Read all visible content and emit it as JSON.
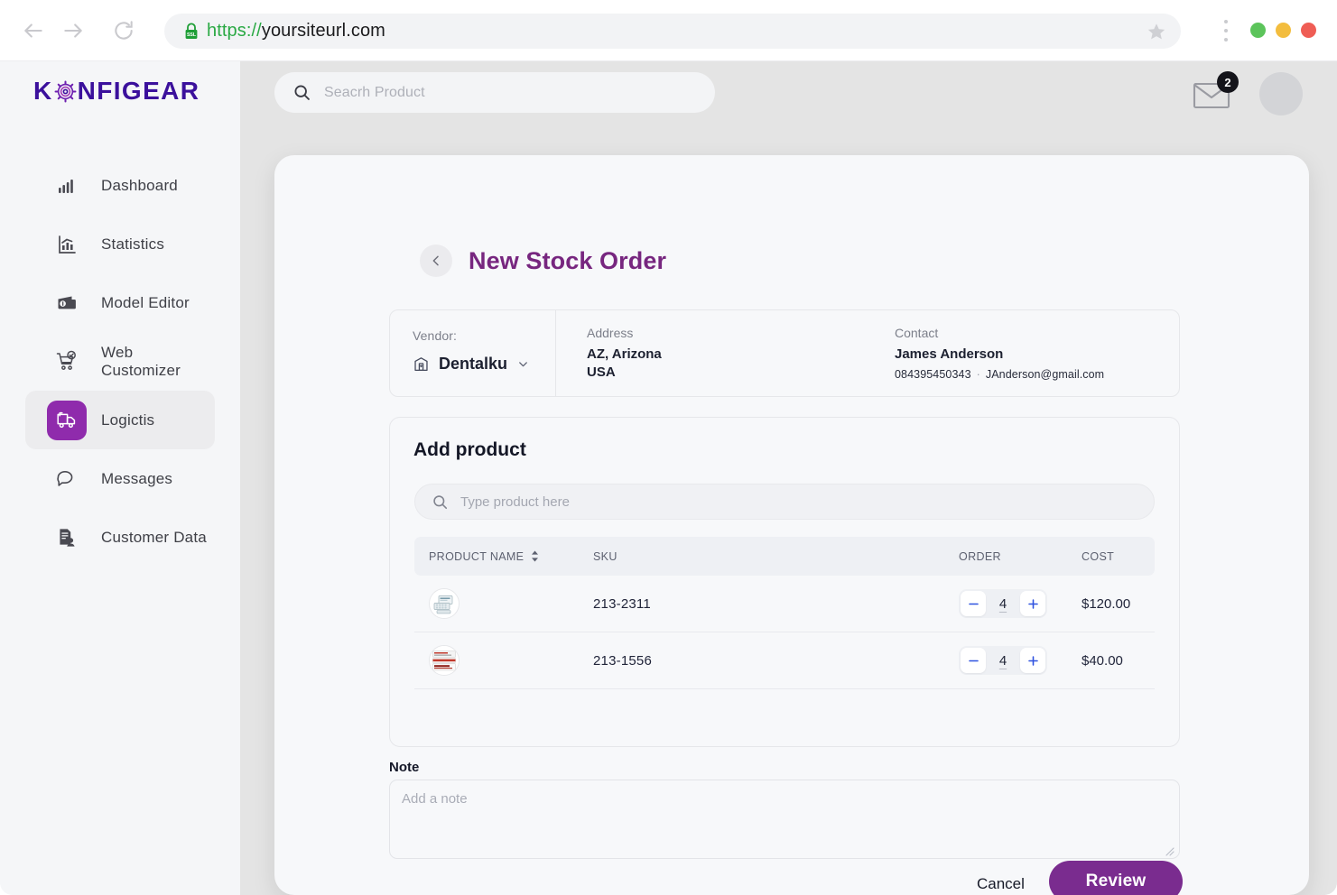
{
  "browser": {
    "back_icon": "arrow-left-icon",
    "forward_icon": "arrow-right-icon",
    "reload_icon": "reload-icon",
    "lock_label": "SSL",
    "url_scheme": "https://",
    "url_host": "yoursiteurl.com",
    "bookmark_icon": "star-icon",
    "menu_icon": "kebab-menu-icon",
    "window_dots": [
      "#5cc45b",
      "#f3bd3e",
      "#ef5d55"
    ]
  },
  "sidebar": {
    "logo": {
      "before": "K",
      "gear": "gear-icon",
      "after": "NFIGEAR"
    },
    "items": [
      {
        "label": "Dashboard",
        "icon": "bar-chart-icon",
        "active": false
      },
      {
        "label": "Statistics",
        "icon": "statistics-chart-icon",
        "active": false
      },
      {
        "label": "Model Editor",
        "icon": "wallet-icon",
        "active": false
      },
      {
        "label": "Web Customizer",
        "icon": "cart-check-icon",
        "active": false
      },
      {
        "label": "Logictis",
        "icon": "truck-icon",
        "active": true
      },
      {
        "label": "Messages",
        "icon": "chat-bubble-icon",
        "active": false
      },
      {
        "label": "Customer Data",
        "icon": "document-user-icon",
        "active": false
      }
    ],
    "active_color": "#8f2bac"
  },
  "topbar": {
    "search_placeholder": "Seacrh Product",
    "search_value": "",
    "search_icon": "search-icon",
    "mail_icon": "envelope-icon",
    "mail_badge": "2",
    "avatar": "user-avatar"
  },
  "page": {
    "back_icon": "chevron-left-icon",
    "title": "New Stock Order",
    "title_color": "#77267f"
  },
  "vendor": {
    "vendor_label": "Vendor:",
    "vendor_name": "Dentalku",
    "vendor_icon": "clinic-building-icon",
    "chevron_icon": "chevron-down-icon",
    "address_label": "Address",
    "address_line1": "AZ, Arizona",
    "address_line2": "USA",
    "contact_label": "Contact",
    "contact_name": "James Anderson",
    "contact_phone": "084395450343",
    "contact_separator": "·",
    "contact_email": "JAnderson@gmail.com"
  },
  "add_product": {
    "title": "Add product",
    "search_placeholder": "Type product here",
    "search_value": "",
    "search_icon": "search-icon",
    "columns": {
      "product_name": "PRODUCT NAME",
      "sku": "SKU",
      "order": "ORDER",
      "cost": "COST",
      "sort_icon": "sort-arrows-icon"
    },
    "rows": [
      {
        "thumb": "product-thumbnail-blister-pack",
        "sku": "213-2311",
        "quantity": "4",
        "cost": "$120.00",
        "minus_icon": "minus-icon",
        "plus_icon": "plus-icon"
      },
      {
        "thumb": "product-thumbnail-red-box",
        "sku": "213-1556",
        "quantity": "4",
        "cost": "$40.00",
        "minus_icon": "minus-icon",
        "plus_icon": "plus-icon"
      }
    ]
  },
  "note": {
    "label": "Note",
    "placeholder": "Add a note",
    "value": "",
    "resize_icon": "resize-handle-icon"
  },
  "footer": {
    "cancel_label": "Cancel",
    "review_label": "Review",
    "review_color": "#7a2c8f"
  }
}
